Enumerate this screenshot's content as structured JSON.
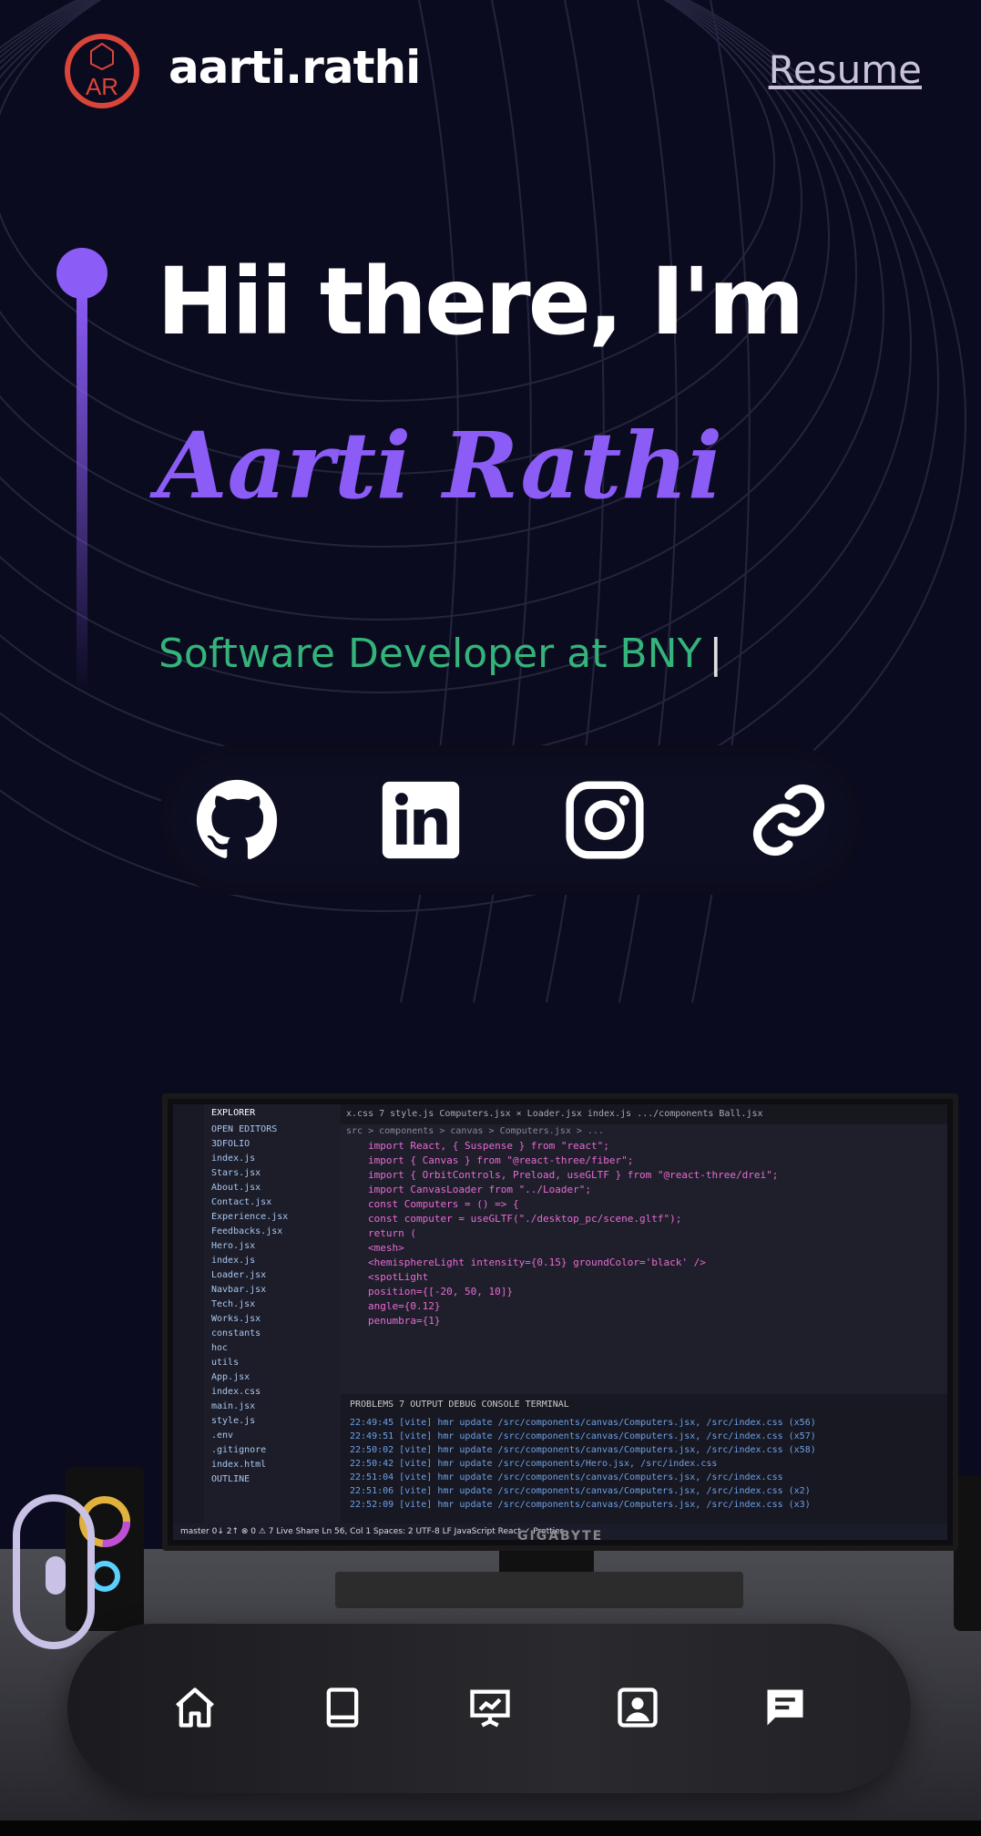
{
  "header": {
    "logo_text": "AR",
    "brand": "aarti.rathi",
    "resume_label": "Resume"
  },
  "hero": {
    "greeting": "Hii there, I'm",
    "name": "Aarti Rathi",
    "role": "Software Developer at BNY",
    "cursor": "|"
  },
  "socials": [
    {
      "name": "github",
      "icon": "github-icon"
    },
    {
      "name": "linkedin",
      "icon": "linkedin-icon"
    },
    {
      "name": "instagram",
      "icon": "instagram-icon"
    },
    {
      "name": "link",
      "icon": "link-icon"
    }
  ],
  "monitor": {
    "brand": "GIGABYTE",
    "tabs": "x.css 7   style.js   Computers.jsx ×   Loader.jsx   index.js .../components   Ball.jsx",
    "breadcrumb": "src > components > canvas > Computers.jsx > ...",
    "explorer_title": "EXPLORER",
    "explorer_items": [
      "OPEN EDITORS",
      "3DFOLIO",
      "index.js",
      "Stars.jsx",
      "About.jsx",
      "Contact.jsx",
      "Experience.jsx",
      "Feedbacks.jsx",
      "Hero.jsx",
      "index.js",
      "Loader.jsx",
      "Navbar.jsx",
      "Tech.jsx",
      "Works.jsx",
      "constants",
      "hoc",
      "utils",
      "App.jsx",
      "index.css",
      "main.jsx",
      "style.js",
      ".env",
      ".gitignore",
      "index.html",
      "OUTLINE"
    ],
    "code_lines": [
      "import React, { Suspense } from \"react\";",
      "import { Canvas } from \"@react-three/fiber\";",
      "import { OrbitControls, Preload, useGLTF } from \"@react-three/drei\";",
      "",
      "import CanvasLoader from \"../Loader\";",
      "",
      "const Computers = () => {",
      "  const computer = useGLTF(\"./desktop_pc/scene.gltf\");",
      "",
      "  return (",
      "    <mesh>",
      "      <hemisphereLight intensity={0.15} groundColor='black' />",
      "      <spotLight",
      "        position={[-20, 50, 10]}",
      "        angle={0.12}",
      "        penumbra={1}"
    ],
    "terminal_tabs": "PROBLEMS  7   OUTPUT   DEBUG CONSOLE   TERMINAL",
    "terminal_lines": [
      "22:49:45 [vite] hmr update /src/components/canvas/Computers.jsx, /src/index.css (x56)",
      "22:49:51 [vite] hmr update /src/components/canvas/Computers.jsx, /src/index.css (x57)",
      "22:50:02 [vite] hmr update /src/components/canvas/Computers.jsx, /src/index.css (x58)",
      "22:50:42 [vite] hmr update /src/components/Hero.jsx, /src/index.css",
      "22:51:04 [vite] hmr update /src/components/canvas/Computers.jsx, /src/index.css",
      "22:51:06 [vite] hmr update /src/components/canvas/Computers.jsx, /src/index.css (x2)",
      "22:52:09 [vite] hmr update /src/components/canvas/Computers.jsx, /src/index.css (x3)"
    ],
    "status_bar": "master   0↓ 2↑   ⊗ 0 ⚠ 7   Live Share          Ln 56, Col 1   Spaces: 2   UTF-8   LF   JavaScript React   ✓ Prettier"
  },
  "nav": [
    {
      "name": "home",
      "icon": "home-icon"
    },
    {
      "name": "book",
      "icon": "book-icon"
    },
    {
      "name": "presentation",
      "icon": "presentation-icon"
    },
    {
      "name": "contact-card",
      "icon": "contact-card-icon"
    },
    {
      "name": "chat",
      "icon": "chat-icon"
    }
  ],
  "colors": {
    "background": "#0b0b1f",
    "accent": "#8b5cf6",
    "role": "#34b37a",
    "logo": "#d9453a"
  }
}
